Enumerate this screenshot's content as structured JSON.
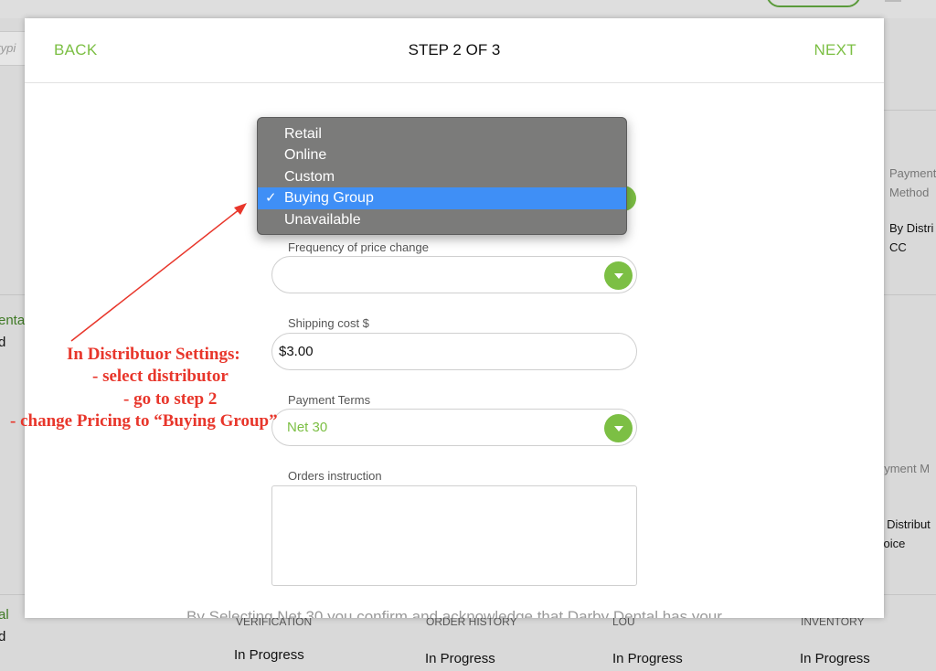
{
  "modal": {
    "back_label": "BACK",
    "title": "STEP 2 OF 3",
    "next_label": "NEXT",
    "dropdown": {
      "options": [
        "Retail",
        "Online",
        "Custom",
        "Buying Group",
        "Unavailable"
      ],
      "selected": "Buying Group",
      "check": "✓"
    },
    "frequency": {
      "label": "Frequency of price change",
      "value": ""
    },
    "shipping": {
      "label": "Shipping cost $",
      "value": "$3.00"
    },
    "payment_terms": {
      "label": "Payment Terms",
      "value": "Net 30"
    },
    "orders_instruction": {
      "label": "Orders instruction",
      "value": ""
    },
    "disclaimer": "By Selecting Net 30 you confirm and acknowledge that Darby Dental has your"
  },
  "annotation": {
    "lines": [
      "In Distribtuor Settings:",
      "- select distributor",
      "- go to step 2",
      "- change Pricing to “Buying Group”"
    ],
    "color": "#e8362b"
  },
  "background": {
    "search_placeholder": "typi",
    "right_col_top": {
      "label_1": "Payment",
      "label_2": "Method",
      "value_1": "By Distri",
      "value_2": "CC"
    },
    "right_col_mid": {
      "label": "ayment M",
      "value_1": "y Distribut",
      "value_2": "voice"
    },
    "left_col_top": {
      "name": "enta",
      "sub": "d"
    },
    "left_col_bottom": {
      "name": "al",
      "sub": "d"
    },
    "columns": [
      "VERIFICATION",
      "ORDER HISTORY",
      "LOU",
      "INVENTORY"
    ],
    "statuses": [
      "In Progress",
      "In Progress",
      "In Progress",
      "In Progress"
    ]
  },
  "colors": {
    "accent_green": "#7cbf44",
    "menu_selected": "#3f8ff6",
    "menu_bg": "#7b7b7a"
  }
}
